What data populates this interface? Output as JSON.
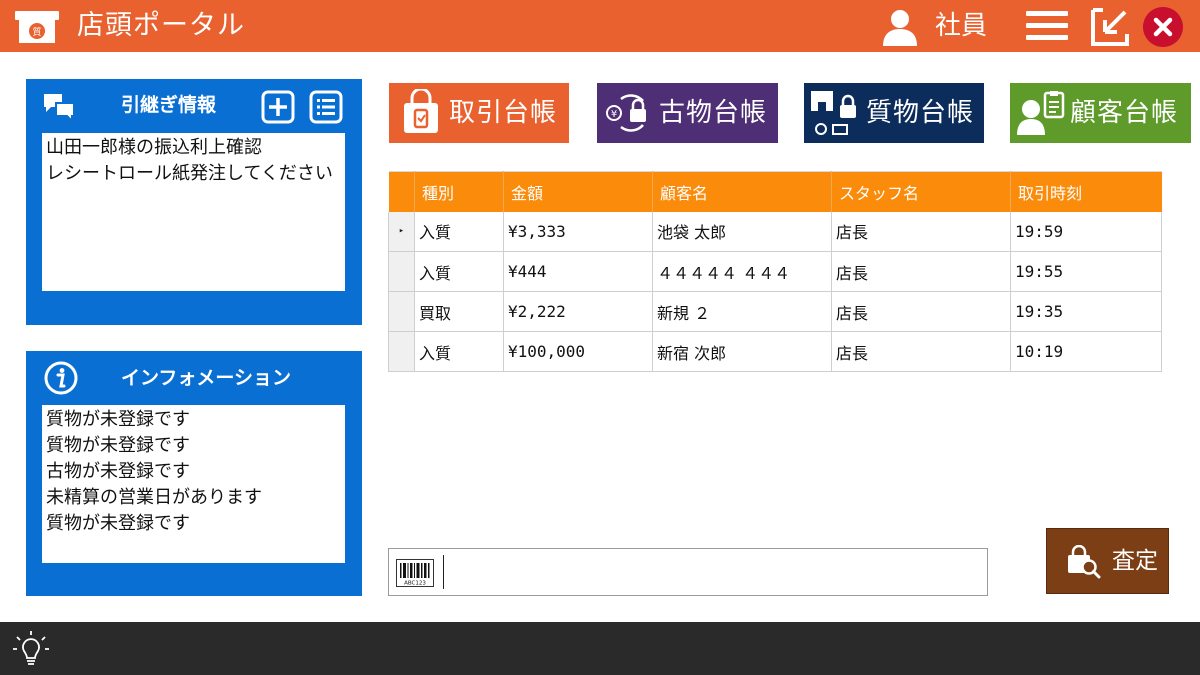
{
  "header": {
    "title": "店頭ポータル",
    "logo_icon": "pawnshop-storefront-icon",
    "user_label": "社員",
    "colors": {
      "bar": "#e8612f",
      "close": "#c8102e"
    }
  },
  "handover_panel": {
    "title": "引継ぎ情報",
    "lines": [
      "山田一郎様の振込利上確認",
      "レシートロール紙発注してください"
    ]
  },
  "info_panel": {
    "title": "インフォメーション",
    "lines": [
      "質物が未登録です",
      "質物が未登録です",
      "古物が未登録です",
      "未精算の営業日があります",
      "質物が未登録です"
    ]
  },
  "ledger_buttons": [
    {
      "label": "取引台帳",
      "color": "#e8612f"
    },
    {
      "label": "古物台帳",
      "color": "#4e2e74"
    },
    {
      "label": "質物台帳",
      "color": "#0c2c5c"
    },
    {
      "label": "顧客台帳",
      "color": "#5e9b2b"
    }
  ],
  "table": {
    "columns": [
      "種別",
      "金額",
      "顧客名",
      "スタッフ名",
      "取引時刻"
    ],
    "rows": [
      {
        "selected": true,
        "type": "入質",
        "amount": "¥3,333",
        "customer": "池袋 太郎",
        "staff": "店長",
        "time": "19:59"
      },
      {
        "selected": false,
        "type": "入質",
        "amount": "¥444",
        "customer": "４４４４４ ４４４",
        "staff": "店長",
        "time": "19:55"
      },
      {
        "selected": false,
        "type": "買取",
        "amount": "¥2,222",
        "customer": "新規 ２",
        "staff": "店長",
        "time": "19:35"
      },
      {
        "selected": false,
        "type": "入質",
        "amount": "¥100,000",
        "customer": "新宿 次郎",
        "staff": "店長",
        "time": "10:19"
      }
    ],
    "row_marker": "▸",
    "header_color": "#fb8b0a"
  },
  "barcode": {
    "icon_text": "ABC123",
    "value": ""
  },
  "assess_button": {
    "label": "査定",
    "color": "#7b3e15"
  }
}
